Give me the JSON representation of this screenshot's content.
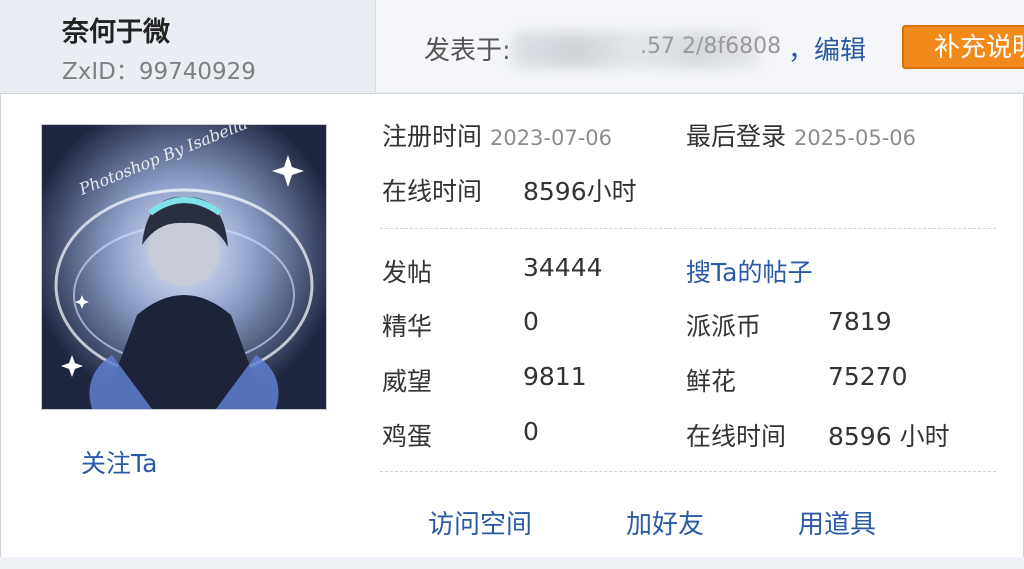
{
  "author": {
    "name": "奈何于微",
    "zxid": "ZxID：99740929"
  },
  "post_meta": {
    "posted_prefix": "发表于:",
    "posted_fragment": ".57  2/8f6808",
    "edit_label": "，编辑",
    "supplement_label": "补充说明"
  },
  "profile": {
    "register_label": "注册时间",
    "register_date": "2023-07-06",
    "last_login_label": "最后登录",
    "last_login_date": "2025-05-06",
    "online_label": "在线时间",
    "online_value": "8596小时",
    "follow_label": "关注Ta",
    "search_posts_label": "搜Ta的帖子",
    "stats": [
      {
        "label": "发帖",
        "value": "34444"
      },
      {
        "label": "精华",
        "value": "0"
      },
      {
        "label": "威望",
        "value": "9811"
      },
      {
        "label": "鸡蛋",
        "value": "0"
      }
    ],
    "stats_right": [
      {
        "label": "派派币",
        "value": "7819"
      },
      {
        "label": "鲜花",
        "value": "75270"
      },
      {
        "label": "在线时间",
        "value": "8596 小时"
      }
    ],
    "actions": [
      "访问空间",
      "加好友",
      "用道具"
    ],
    "avatar_watermark": "Photoshop By Isabella"
  },
  "colors": {
    "link": "#2a5aa6",
    "accent_button": "#f28a1b",
    "muted": "#8c8c8c"
  }
}
